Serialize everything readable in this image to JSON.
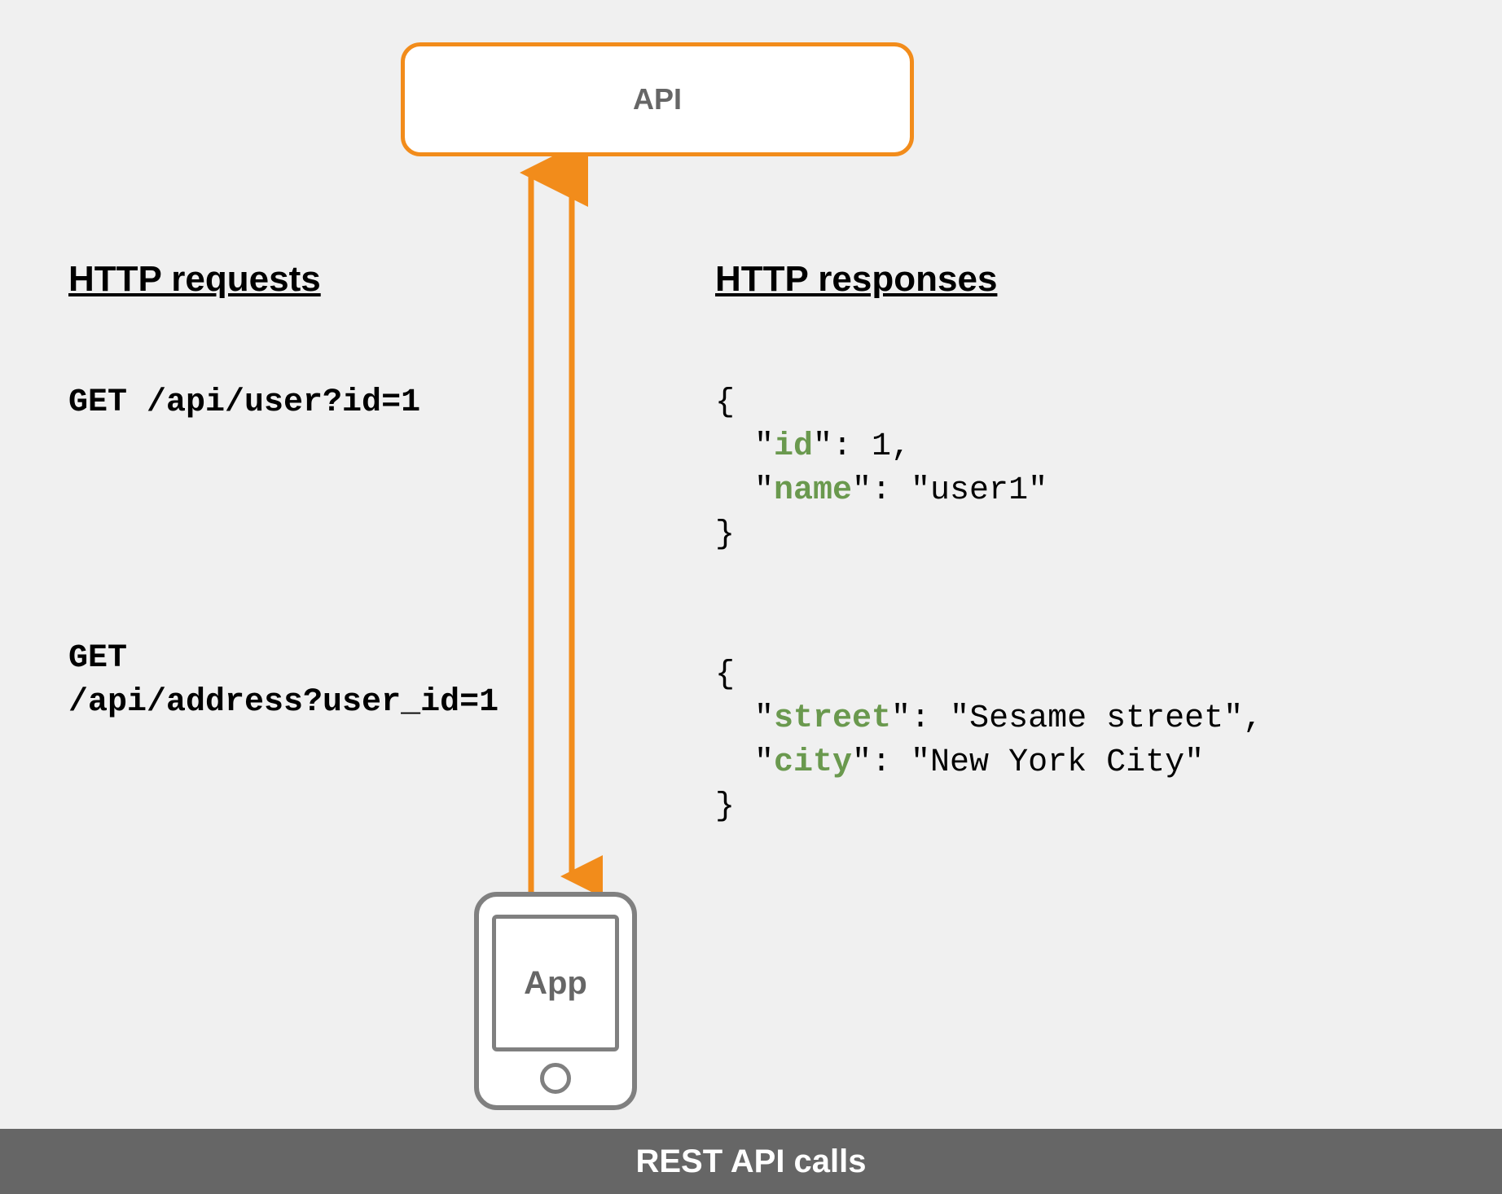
{
  "nodes": {
    "api_label": "API",
    "app_label": "App"
  },
  "columns": {
    "requests_heading": "HTTP requests",
    "responses_heading": "HTTP responses"
  },
  "requests": {
    "req1": "GET /api/user?id=1",
    "req2": "GET\n/api/address?user_id=1"
  },
  "responses": {
    "resp1": {
      "lines": [
        {
          "text": "{"
        },
        {
          "indent": "  \"",
          "key": "id",
          "rest": "\": 1,"
        },
        {
          "indent": "  \"",
          "key": "name",
          "rest": "\": \"user1\""
        },
        {
          "text": "}"
        }
      ]
    },
    "resp2": {
      "lines": [
        {
          "text": "{"
        },
        {
          "indent": "  \"",
          "key": "street",
          "rest": "\": \"Sesame street\","
        },
        {
          "indent": "  \"",
          "key": "city",
          "rest": "\": \"New York City\""
        },
        {
          "text": "}"
        }
      ]
    }
  },
  "footer": {
    "label": "REST API calls"
  },
  "colors": {
    "accent": "#f28c1b",
    "device": "#808080",
    "json_key": "#6a994e",
    "footer_bg": "#666"
  }
}
